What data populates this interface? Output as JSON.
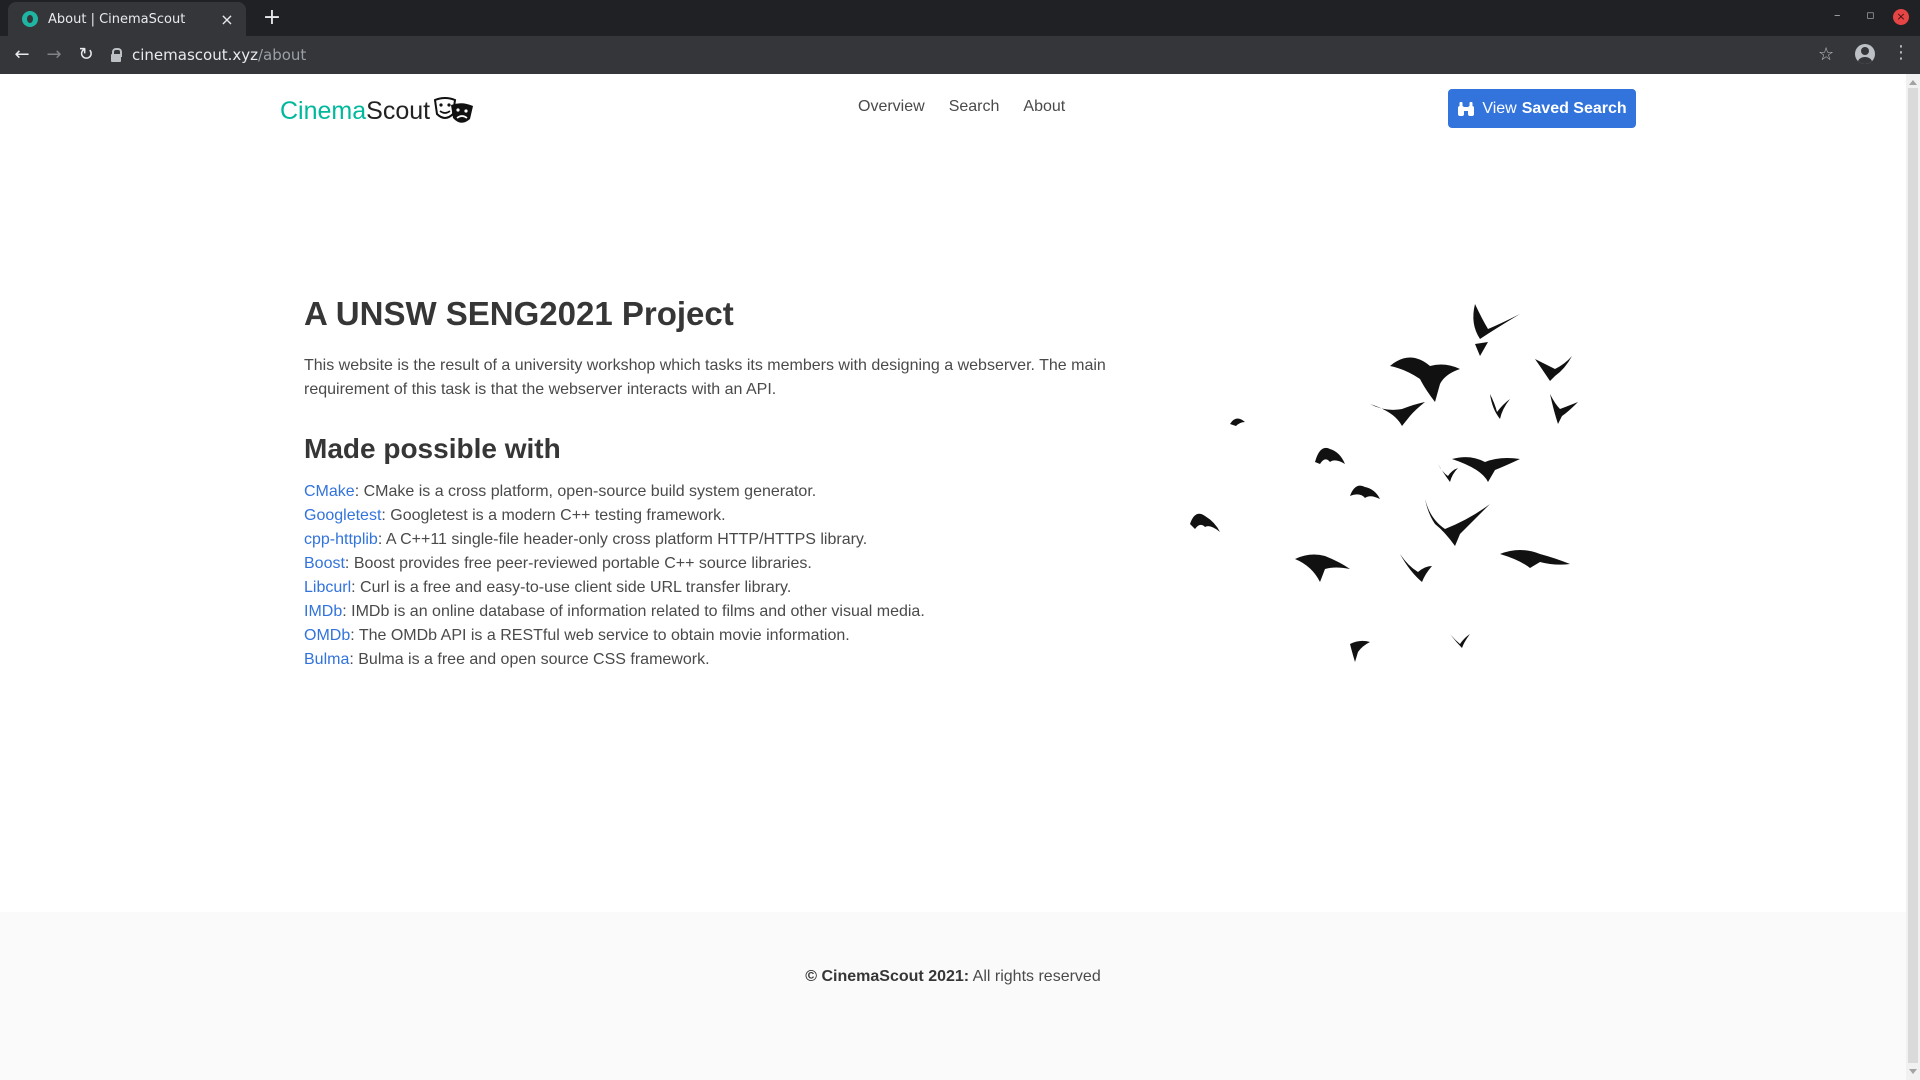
{
  "browser": {
    "tab_title": "About | CinemaScout",
    "tab_close": "×",
    "new_tab": "+",
    "url_host": "cinemascout.xyz",
    "url_path": "/about",
    "minimize": "–",
    "restore": "▫",
    "close": "×"
  },
  "site": {
    "brand_part1": "Cinema",
    "brand_part2": "Scout",
    "nav": [
      "Overview",
      "Search",
      "About"
    ],
    "cta_label_regular": "View",
    "cta_label_bold": "Saved Search"
  },
  "content": {
    "title": "A UNSW SENG2021 Project",
    "intro": "This website is the result of a university workshop which tasks its members with designing a webserver. The main requirement of this task is that the webserver interacts with an API.",
    "subtitle": "Made possible with",
    "libraries": [
      {
        "name": "CMake",
        "desc": ": CMake is a cross platform, open-source build system generator."
      },
      {
        "name": "Googletest",
        "desc": ": Googletest is a modern C++ testing framework."
      },
      {
        "name": "cpp-httplib",
        "desc": ": A C++11 single-file header-only cross platform HTTP/HTTPS library."
      },
      {
        "name": "Boost",
        "desc": ": Boost provides free peer-reviewed portable C++ source libraries."
      },
      {
        "name": "Libcurl",
        "desc": ": Curl is a free and easy-to-use client side URL transfer library."
      },
      {
        "name": "IMDb",
        "desc": ": IMDb is an online database of information related to films and other visual media."
      },
      {
        "name": "OMDb",
        "desc": ": The OMDb API is a RESTful web service to obtain movie information."
      },
      {
        "name": "Bulma",
        "desc": ": Bulma is a free and open source CSS framework."
      }
    ]
  },
  "footer": {
    "strong": "© CinemaScout 2021:",
    "text": " All rights reserved"
  },
  "colors": {
    "accent": "#00b89c",
    "primary": "#3273dc",
    "link": "#3273dc"
  },
  "icons": [
    "favicon-icon",
    "close-icon",
    "plus-icon",
    "back-icon",
    "forward-icon",
    "reload-icon",
    "lock-icon",
    "star-icon",
    "profile-icon",
    "menu-icon",
    "theater-masks-icon",
    "binoculars-icon",
    "birds-illustration"
  ]
}
